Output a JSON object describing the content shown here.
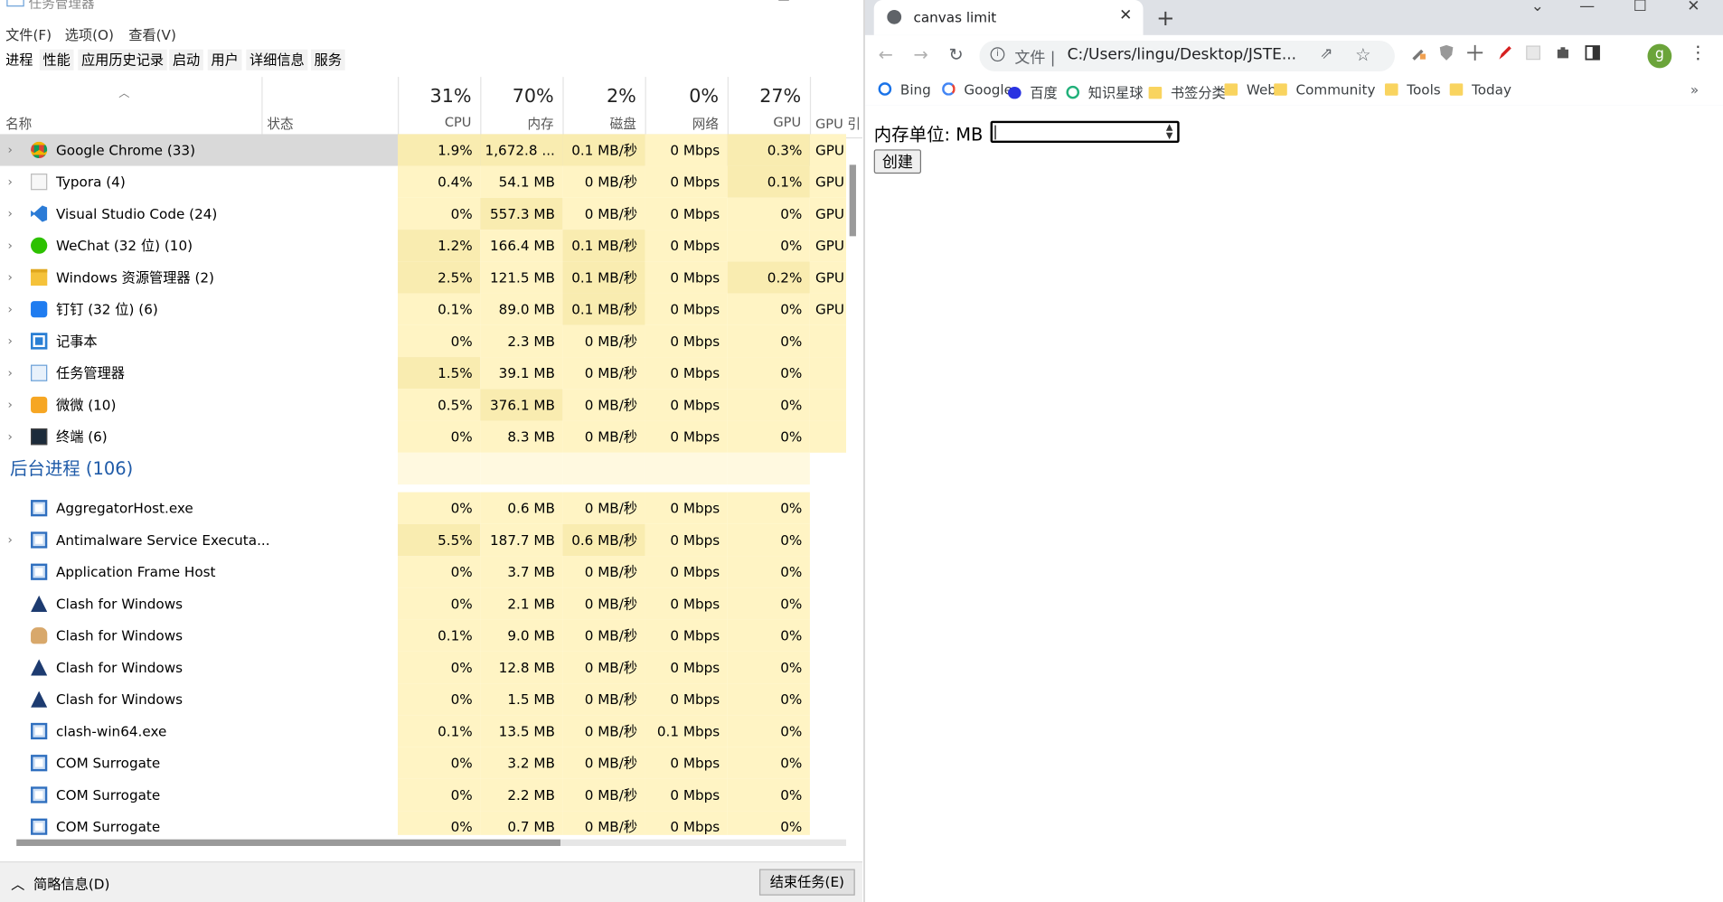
{
  "task_manager": {
    "title": "任务管理器",
    "menu": [
      "文件(F)",
      "选项(O)",
      "查看(V)"
    ],
    "tabs": [
      "进程",
      "性能",
      "应用历史记录",
      "启动",
      "用户",
      "详细信息",
      "服务"
    ],
    "columns": {
      "name": "名称",
      "status": "状态",
      "cpu": {
        "pct": "31%",
        "label": "CPU"
      },
      "memory": {
        "pct": "70%",
        "label": "内存"
      },
      "disk": {
        "pct": "2%",
        "label": "磁盘"
      },
      "network": {
        "pct": "0%",
        "label": "网络"
      },
      "gpu": {
        "pct": "27%",
        "label": "GPU"
      },
      "gpu_engine": {
        "label": "GPU 引"
      }
    },
    "apps": [
      {
        "name": "Google Chrome (33)",
        "cpu": "1.9%",
        "mem": "1,672.8 ...",
        "disk": "0.1 MB/秒",
        "net": "0 Mbps",
        "gpu": "0.3%",
        "engine": "GPU",
        "icon": "chrome-icon"
      },
      {
        "name": "Typora (4)",
        "cpu": "0.4%",
        "mem": "54.1 MB",
        "disk": "0 MB/秒",
        "net": "0 Mbps",
        "gpu": "0.1%",
        "engine": "GPU",
        "icon": "typora-icon"
      },
      {
        "name": "Visual Studio Code (24)",
        "cpu": "0%",
        "mem": "557.3 MB",
        "disk": "0 MB/秒",
        "net": "0 Mbps",
        "gpu": "0%",
        "engine": "GPU",
        "icon": "vscode-icon"
      },
      {
        "name": "WeChat (32 位) (10)",
        "cpu": "1.2%",
        "mem": "166.4 MB",
        "disk": "0.1 MB/秒",
        "net": "0 Mbps",
        "gpu": "0%",
        "engine": "GPU",
        "icon": "wechat-icon"
      },
      {
        "name": "Windows 资源管理器 (2)",
        "cpu": "2.5%",
        "mem": "121.5 MB",
        "disk": "0.1 MB/秒",
        "net": "0 Mbps",
        "gpu": "0.2%",
        "engine": "GPU",
        "icon": "folder-icon"
      },
      {
        "name": "钉钉 (32 位) (6)",
        "cpu": "0.1%",
        "mem": "89.0 MB",
        "disk": "0.1 MB/秒",
        "net": "0 Mbps",
        "gpu": "0%",
        "engine": "GPU",
        "icon": "dingtalk-icon"
      },
      {
        "name": "记事本",
        "cpu": "0%",
        "mem": "2.3 MB",
        "disk": "0 MB/秒",
        "net": "0 Mbps",
        "gpu": "0%",
        "engine": "",
        "icon": "notepad-icon"
      },
      {
        "name": "任务管理器",
        "cpu": "1.5%",
        "mem": "39.1 MB",
        "disk": "0 MB/秒",
        "net": "0 Mbps",
        "gpu": "0%",
        "engine": "",
        "icon": "taskmgr-icon"
      },
      {
        "name": "微微 (10)",
        "cpu": "0.5%",
        "mem": "376.1 MB",
        "disk": "0 MB/秒",
        "net": "0 Mbps",
        "gpu": "0%",
        "engine": "",
        "icon": "weiwei-icon"
      },
      {
        "name": "终端 (6)",
        "cpu": "0%",
        "mem": "8.3 MB",
        "disk": "0 MB/秒",
        "net": "0 Mbps",
        "gpu": "0%",
        "engine": "",
        "icon": "terminal-icon"
      }
    ],
    "background_header": "后台进程 (106)",
    "background": [
      {
        "name": "AggregatorHost.exe",
        "cpu": "0%",
        "mem": "0.6 MB",
        "disk": "0 MB/秒",
        "net": "0 Mbps",
        "gpu": "0%",
        "icon": "window-icon",
        "expand": false
      },
      {
        "name": "Antimalware Service Executa...",
        "cpu": "5.5%",
        "mem": "187.7 MB",
        "disk": "0.6 MB/秒",
        "net": "0 Mbps",
        "gpu": "0%",
        "icon": "window-icon",
        "expand": true
      },
      {
        "name": "Application Frame Host",
        "cpu": "0%",
        "mem": "3.7 MB",
        "disk": "0 MB/秒",
        "net": "0 Mbps",
        "gpu": "0%",
        "icon": "window-icon",
        "expand": false
      },
      {
        "name": "Clash for Windows",
        "cpu": "0%",
        "mem": "2.1 MB",
        "disk": "0 MB/秒",
        "net": "0 Mbps",
        "gpu": "0%",
        "icon": "clash-icon",
        "expand": false
      },
      {
        "name": "Clash for Windows",
        "cpu": "0.1%",
        "mem": "9.0 MB",
        "disk": "0 MB/秒",
        "net": "0 Mbps",
        "gpu": "0%",
        "icon": "clash-cat-icon",
        "expand": false
      },
      {
        "name": "Clash for Windows",
        "cpu": "0%",
        "mem": "12.8 MB",
        "disk": "0 MB/秒",
        "net": "0 Mbps",
        "gpu": "0%",
        "icon": "clash-icon",
        "expand": false
      },
      {
        "name": "Clash for Windows",
        "cpu": "0%",
        "mem": "1.5 MB",
        "disk": "0 MB/秒",
        "net": "0 Mbps",
        "gpu": "0%",
        "icon": "clash-icon",
        "expand": false
      },
      {
        "name": "clash-win64.exe",
        "cpu": "0.1%",
        "mem": "13.5 MB",
        "disk": "0 MB/秒",
        "net": "0.1 Mbps",
        "gpu": "0%",
        "icon": "window-icon",
        "expand": false
      },
      {
        "name": "COM Surrogate",
        "cpu": "0%",
        "mem": "3.2 MB",
        "disk": "0 MB/秒",
        "net": "0 Mbps",
        "gpu": "0%",
        "icon": "window-icon",
        "expand": false
      },
      {
        "name": "COM Surrogate",
        "cpu": "0%",
        "mem": "2.2 MB",
        "disk": "0 MB/秒",
        "net": "0 Mbps",
        "gpu": "0%",
        "icon": "window-icon",
        "expand": false
      },
      {
        "name": "COM Surrogate",
        "cpu": "0%",
        "mem": "0.7 MB",
        "disk": "0 MB/秒",
        "net": "0 Mbps",
        "gpu": "0%",
        "icon": "window-icon",
        "expand": false
      }
    ],
    "footer": {
      "less_details": "简略信息(D)",
      "end_task": "结束任务(E)"
    }
  },
  "chrome": {
    "tab_title": "canvas limit",
    "omnibox": {
      "scheme": "文件 |",
      "url": "C:/Users/lingu/Desktop/JSTE..."
    },
    "avatar_letter": "g",
    "bookmarks": [
      {
        "label": "Bing",
        "icon": "search-icon"
      },
      {
        "label": "Google",
        "icon": "google-icon"
      },
      {
        "label": "百度",
        "icon": "baidu-icon"
      },
      {
        "label": "知识星球",
        "icon": "planet-icon"
      },
      {
        "label": "书签分类",
        "icon": "folder-icon"
      },
      {
        "label": "Web",
        "icon": "folder-icon"
      },
      {
        "label": "Community",
        "icon": "folder-icon"
      },
      {
        "label": "Tools",
        "icon": "folder-icon"
      },
      {
        "label": "Today",
        "icon": "folder-icon"
      }
    ],
    "page": {
      "mem_label": "内存单位: MB",
      "mem_value": "",
      "create_button": "创建"
    }
  }
}
